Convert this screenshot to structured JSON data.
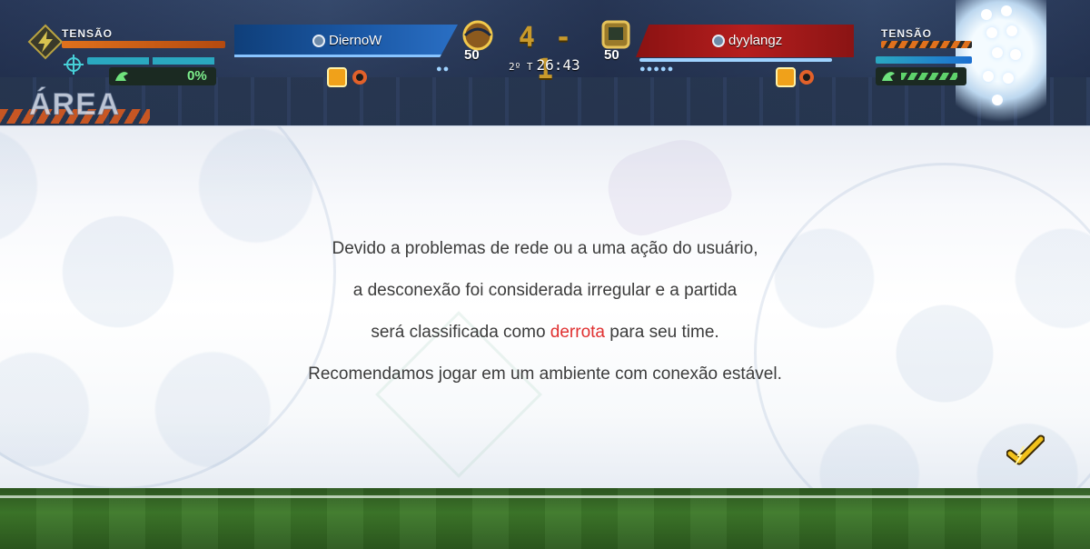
{
  "hud": {
    "left_tension": {
      "label": "TENSÃO",
      "percent": "0%"
    },
    "right_tension": {
      "label": "TENSÃO"
    },
    "area_label": "ÁREA",
    "home": {
      "player": "DiernoW",
      "team_number": "50",
      "stamina_drops": 2,
      "accent": "#1c5aa8"
    },
    "away": {
      "player": "dyylangz",
      "team_number": "50",
      "stamina_drops": 5,
      "accent": "#b51e1e"
    },
    "score": {
      "home": "4",
      "separator": "-",
      "away": "1"
    },
    "clock": {
      "half": "2º T",
      "time": "26:43"
    }
  },
  "dialog": {
    "line1": "Devido a problemas de rede ou a uma ação do usuário,",
    "line2": "a desconexão foi considerada irregular e a partida",
    "line3_before": "será classificada como ",
    "line3_highlight": "derrota",
    "line3_after": " para seu time.",
    "line4": "Recomendamos jogar em um ambiente com conexão estável.",
    "highlight_color": "#e03030",
    "confirm_icon": "checkmark-icon"
  },
  "icons": {
    "steam": "steam-icon",
    "lightning": "lightning-icon",
    "crosshair": "crosshair-icon",
    "kick": "kick-icon"
  }
}
